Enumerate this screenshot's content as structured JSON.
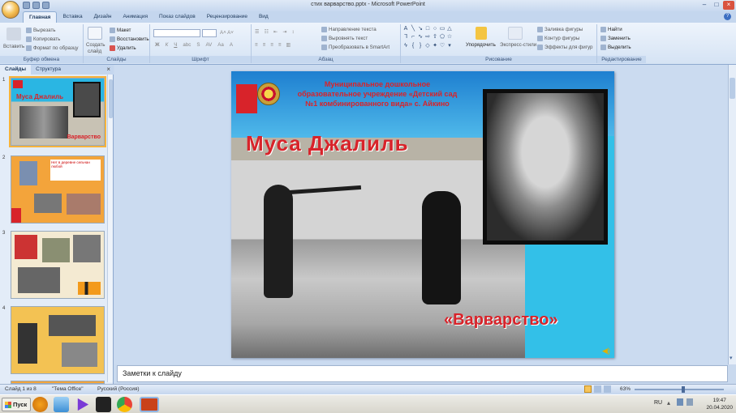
{
  "window": {
    "title": "стих варварство.pptx - Microsoft PowerPoint"
  },
  "tabs": [
    "Главная",
    "Вставка",
    "Дизайн",
    "Анимация",
    "Показ слайдов",
    "Рецензирование",
    "Вид"
  ],
  "ribbon": {
    "clipboard": {
      "cut": "Вырезать",
      "copy": "Копировать",
      "format_painter": "Формат по образцу",
      "paste": "Вставить",
      "label": "Буфер обмена"
    },
    "slides": {
      "new_slide_1": "Создать",
      "new_slide_2": "слайд",
      "layout": "Макет",
      "reset": "Восстановить",
      "delete": "Удалить",
      "label": "Слайды"
    },
    "font": {
      "label": "Шрифт"
    },
    "paragraph": {
      "text_direction": "Направление текста",
      "align_text": "Выровнять текст",
      "smartart": "Преобразовать в SmartArt",
      "label": "Абзац"
    },
    "drawing": {
      "arrange": "Упорядочить",
      "quick_styles": "Экспресс-стили",
      "fill": "Заливка фигуры",
      "outline": "Контур фигуры",
      "effects": "Эффекты для фигур",
      "label": "Рисование"
    },
    "editing": {
      "find": "Найти",
      "replace": "Заменить",
      "select": "Выделить",
      "label": "Редактирование"
    }
  },
  "pane": {
    "tab_slides": "Слайды",
    "tab_outline": "Структура",
    "close": "×",
    "numbers": [
      "1",
      "2",
      "3",
      "4"
    ]
  },
  "slide": {
    "institution": "Муниципальное дошкольное образовательное учреждение «Детский сад №1 комбинированного вида» с. Айкино",
    "title": "Муса Джалиль",
    "subtitle": "«Варварство»"
  },
  "thumb1": {
    "title": "Муса Джалиль",
    "subtitle": "Варварство"
  },
  "thumb2": {
    "caption": "Нет в деревне сельчан любой"
  },
  "notes": {
    "placeholder": "Заметки к слайду"
  },
  "status": {
    "slide_info": "Слайд 1 из 8",
    "theme": "\"Тема Office\"",
    "language": "Русский (Россия)",
    "zoom": "63%"
  },
  "taskbar": {
    "start": "Пуск",
    "lang": "RU",
    "time": "19:47",
    "date": "20.04.2020"
  },
  "colors": {
    "accent": "#f6b33c",
    "ribbon": "#dbe6f4",
    "slide_red": "#d8232a",
    "slide_cyan": "#2ab6e3"
  }
}
